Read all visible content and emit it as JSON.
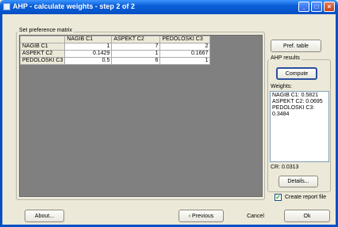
{
  "window": {
    "title": "AHP - calculate weights - step 2 of 2",
    "minimize_glyph": "_",
    "maximize_glyph": "□",
    "close_glyph": "×"
  },
  "preference_matrix": {
    "caption": "Set preference matrix",
    "columns": [
      "NAGIB C1",
      "ASPEKT C2",
      "PEDOLOSKI C3"
    ],
    "rows": [
      {
        "label": "NAGIB C1",
        "values": [
          "1",
          "7",
          "2"
        ]
      },
      {
        "label": "ASPEKT C2",
        "values": [
          "0.1429",
          "1",
          "0.1667"
        ]
      },
      {
        "label": "PEDOLOSKI C3",
        "values": [
          "0.5",
          "6",
          "1"
        ]
      }
    ]
  },
  "right_panel": {
    "pref_table_label": "Pref. table",
    "results_caption": "AHP results",
    "compute_label": "Compute",
    "weights_label": "Weights:",
    "weights_text": "NAGIB C1: 0.5821\nASPEKT C2: 0.0695\nPEDOLOSKI C3:\n0.3484",
    "cr_text": "CR: 0.0313",
    "details_label": "Details...",
    "create_report_label": "Create report file",
    "create_report_checked": true
  },
  "footer": {
    "about_label": "About...",
    "previous_label": "‹ Previous",
    "cancel_label": "Cancel",
    "ok_label": "Ok"
  }
}
